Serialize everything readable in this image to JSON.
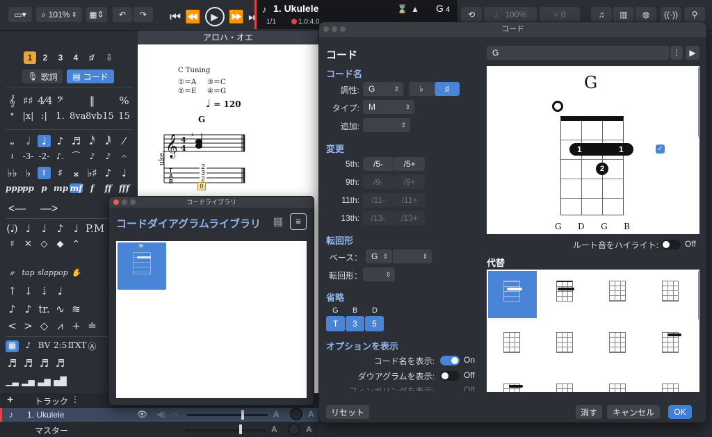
{
  "toolbar": {
    "zoom": "101%",
    "zoom_icon": "magnifier-icon"
  },
  "lcd": {
    "track_name": "1. Ukulele",
    "bar": "1/1",
    "position": "1.0:4.0",
    "key": "G",
    "key_num": "4",
    "tempo_pct": "100%",
    "pitch": "0"
  },
  "score": {
    "title": "アロハ・オエ",
    "tuning_title": "C Tuning",
    "tuning_1": "①＝A",
    "tuning_3": "③＝C",
    "tuning_2": "②＝E",
    "tuning_4": "④＝G",
    "tempo": "= 120",
    "chord": "G",
    "instrument": "uke.",
    "tab_t": "T",
    "tab_a": "A",
    "tab_b": "B",
    "fret_1": "2",
    "fret_2": "3",
    "fret_3": "2",
    "fret_4": "0"
  },
  "palette": {
    "voices": [
      "1",
      "2",
      "3",
      "4"
    ],
    "lyrics_label": "歌詞",
    "chord_label": "コード"
  },
  "tracks": {
    "add_track": "トラック",
    "track1": "1. Ukulele",
    "master": "マスター"
  },
  "library": {
    "window_title": "コードライブラリ",
    "heading": "コードダイアグラムライブラリ",
    "item_chord": "G"
  },
  "dialog": {
    "window_title": "コード",
    "heading": "コード",
    "chord_name_section": "コード名",
    "key_label": "調性:",
    "key_value": "G",
    "flat": "♭",
    "sharp": "♯",
    "type_label": "タイプ:",
    "type_value": "M",
    "add_label": "追加:",
    "alter_section": "変更",
    "alter_5": "5th:",
    "alter_5_minus": "/5-",
    "alter_5_plus": "/5+",
    "alter_9": "9th:",
    "alter_9_minus": "/9-",
    "alter_9_plus": "/9+",
    "alter_11": "11th:",
    "alter_11_minus": "/11-",
    "alter_11_plus": "/11+",
    "alter_13": "13th:",
    "alter_13_minus": "/13-",
    "alter_13_plus": "/13+",
    "inversion_section": "転回形",
    "bass_label": "ベース：",
    "bass_value": "G",
    "inversion_label": "転回形：",
    "omit_section": "省略",
    "omit_notes": [
      "G",
      "B",
      "D"
    ],
    "omit_buttons": [
      "T",
      "3",
      "5"
    ],
    "options_section": "オプションを表示",
    "show_name_label": "コード名を表示:",
    "show_name_state": "On",
    "show_diagram_label": "ダウアグラムを表示:",
    "show_diagram_state": "Off",
    "show_fingering_label": "フィンガリングを表示:",
    "show_fingering_state": "Off",
    "chord_field": "G",
    "diagram_name": "G",
    "string_names": [
      "G",
      "D",
      "G",
      "B"
    ],
    "finger_1a": "1",
    "finger_1b": "1",
    "finger_2": "2",
    "root_highlight_label": "ルート音をハイライト:",
    "root_highlight_state": "Off",
    "alternatives_section": "代替",
    "reset": "リセット",
    "delete": "消す",
    "cancel": "キャンセル",
    "ok": "OK"
  },
  "colors": {
    "accent": "#4a84d6",
    "record": "#e0454a",
    "panel": "#2c2f35"
  }
}
